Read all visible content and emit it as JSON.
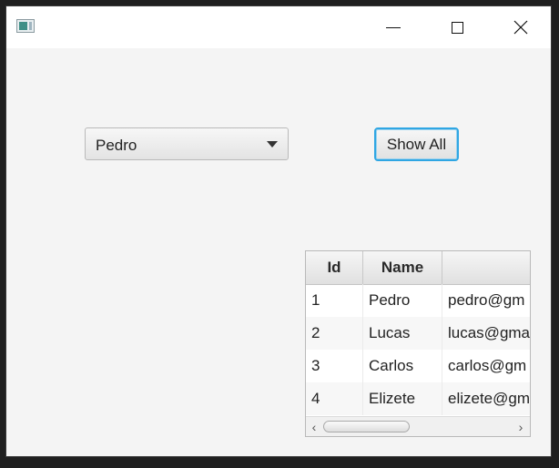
{
  "window": {
    "controls": {
      "minimize_icon": "minimize-icon",
      "maximize_icon": "maximize-icon",
      "close_icon": "close-icon"
    }
  },
  "combo": {
    "selected": "Pedro",
    "arrow_icon": "dropdown-arrow-icon"
  },
  "show_all_button": {
    "label": "Show All",
    "focus_color": "#2fa6e3"
  },
  "table": {
    "columns": [
      "Id",
      "Name",
      ""
    ],
    "rows": [
      {
        "id": "1",
        "name": "Pedro",
        "email": "pedro@gm"
      },
      {
        "id": "2",
        "name": "Lucas",
        "email": "lucas@gma"
      },
      {
        "id": "3",
        "name": "Carlos",
        "email": "carlos@gm"
      },
      {
        "id": "4",
        "name": "Elizete",
        "email": "elizete@gm"
      }
    ],
    "scroll_left_glyph": "‹",
    "scroll_right_glyph": "›"
  }
}
